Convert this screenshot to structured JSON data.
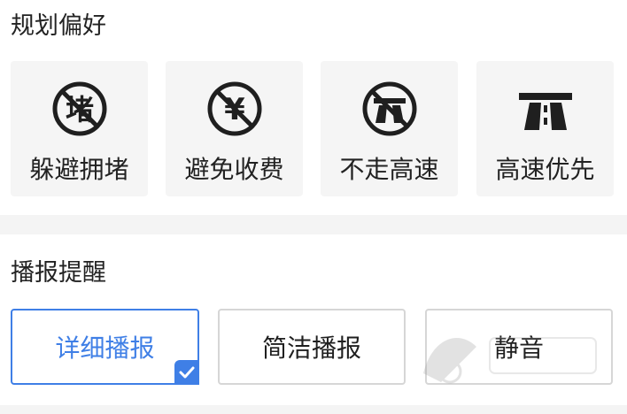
{
  "route_preferences": {
    "title": "规划偏好",
    "items": [
      {
        "label": "躲避拥堵",
        "icon": "no-congestion-icon",
        "icon_text": "堵"
      },
      {
        "label": "避免收费",
        "icon": "no-toll-icon",
        "icon_text": "¥"
      },
      {
        "label": "不走高速",
        "icon": "no-highway-icon"
      },
      {
        "label": "高速优先",
        "icon": "highway-icon"
      }
    ]
  },
  "voice_broadcast": {
    "title": "播报提醒",
    "options": [
      {
        "label": "详细播报",
        "selected": true
      },
      {
        "label": "简洁播报",
        "selected": false
      },
      {
        "label": "静音",
        "selected": false
      }
    ]
  },
  "colors": {
    "accent": "#3f7fe6",
    "card_bg": "#f5f5f5",
    "text": "#222222",
    "border": "#d6d6d6"
  }
}
